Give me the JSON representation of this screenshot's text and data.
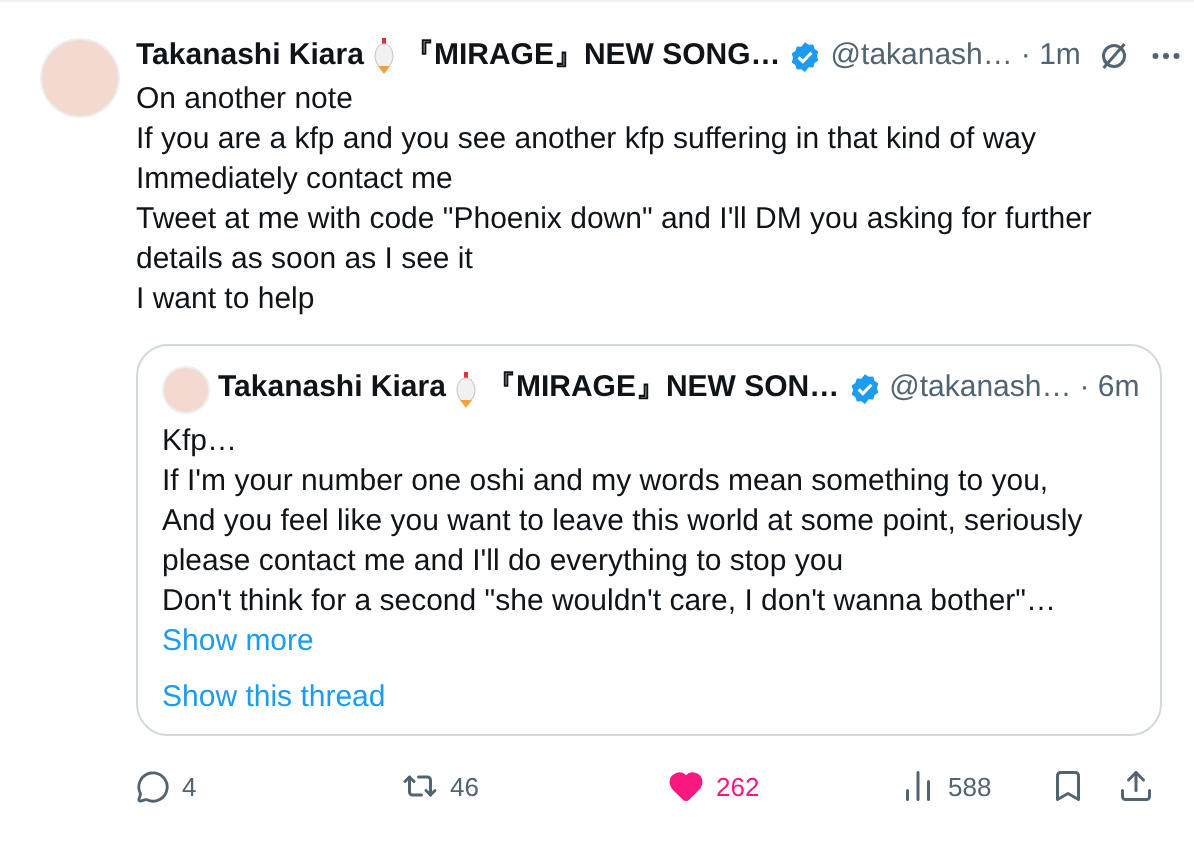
{
  "tweet": {
    "name_start": "Takanashi Kiara",
    "name_end": "『MIRAGE』NEW SONG…",
    "verified": true,
    "handle": "@takanash…",
    "time": "· 1m",
    "lines": [
      "On another note",
      "If you are a kfp and you see another kfp suffering in that kind of way",
      "Immediately contact me",
      "Tweet at me with code \"Phoenix down\" and I'll DM you asking for further details as soon as I see it",
      "I want to help"
    ]
  },
  "quote": {
    "name_start": "Takanashi Kiara",
    "name_end": "『MIRAGE』NEW SON…",
    "verified": true,
    "handle": "@takanash…",
    "time": "· 6m",
    "lines": [
      "Kfp…",
      "If I'm your number one oshi and my words mean something to you,",
      "And you feel like you want to leave this world at some point, seriously please contact me and I'll do everything to stop you",
      "Don't think for a second \"she wouldn't care, I don't wanna bother\"…"
    ],
    "show_more": "Show more",
    "show_thread": "Show this thread"
  },
  "actions": {
    "replies": "4",
    "reposts": "46",
    "likes": "262",
    "liked": true,
    "views": "588"
  }
}
